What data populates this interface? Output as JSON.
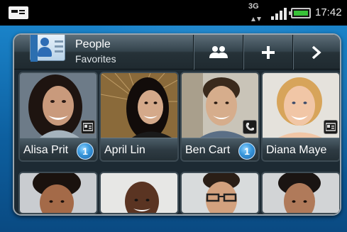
{
  "status_bar": {
    "network_label": "3G",
    "time": "17:42",
    "icons": [
      "notification-icon",
      "network-3g-icon",
      "signal-strength-icon",
      "battery-icon"
    ]
  },
  "widget": {
    "title": "People",
    "subtitle": "Favorites",
    "buttons": [
      {
        "name": "groups-button",
        "icon": "group-icon"
      },
      {
        "name": "add-contact-button",
        "icon": "plus-icon"
      },
      {
        "name": "next-button",
        "icon": "chevron-right-icon"
      }
    ]
  },
  "contacts": [
    {
      "name": "Alisa Prit",
      "badge": "1",
      "status_icon": "contact-card-icon"
    },
    {
      "name": "April Lin",
      "badge": "",
      "status_icon": ""
    },
    {
      "name": "Ben Cart",
      "badge": "1",
      "status_icon": "phone-icon"
    },
    {
      "name": "Diana Maye",
      "badge": "",
      "status_icon": "contact-card-icon"
    }
  ],
  "colors": {
    "status_bar_bg": "#000000",
    "wallpaper": "#0d5f9f",
    "widget_bg": "#1d2a33",
    "badge_blue": "#3796db",
    "battery_green": "#38c238"
  }
}
